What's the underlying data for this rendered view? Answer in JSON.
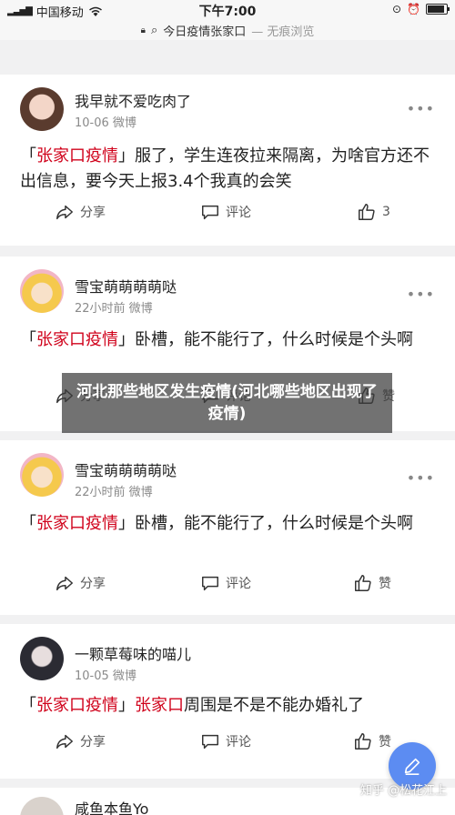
{
  "status": {
    "carrier": "中国移动",
    "time": "下午7:00"
  },
  "url": {
    "title": "今日疫情张家口",
    "suffix": "— 无痕浏览"
  },
  "overlay_title": "河北那些地区发生疫情(河北哪些地区出现了疫情)",
  "watermark": "知乎 @松花江上",
  "posts": [
    {
      "name": "我早就不爱吃肉了",
      "meta": "10-06  微博",
      "prefix": "「",
      "highlight": "张家口疫情",
      "close": "」",
      "highlight2": "",
      "text": "服了，学生连夜拉来隔离，为啥官方还不出信息，要今天上报3.4个我真的会笑",
      "share": "分享",
      "comment": "评论",
      "like": "3"
    },
    {
      "name": "雪宝萌萌萌萌哒",
      "meta": "22小时前  微博",
      "prefix": "「",
      "highlight": "张家口疫情",
      "close": "」",
      "highlight2": "",
      "text": "卧槽，能不能行了，什么时候是个头啊",
      "share": "分享",
      "comment": "评论",
      "like": "赞"
    },
    {
      "name": "雪宝萌萌萌萌哒",
      "meta": "22小时前  微博",
      "prefix": "「",
      "highlight": "张家口疫情",
      "close": "」",
      "highlight2": "",
      "text": "卧槽，能不能行了，什么时候是个头啊",
      "share": "分享",
      "comment": "评论",
      "like": "赞"
    },
    {
      "name": "一颗草莓味的喵儿",
      "meta": "10-05  微博",
      "prefix": "「",
      "highlight": "张家口疫情",
      "close": "」",
      "highlight2": "张家口",
      "text": "周围是不是不能办婚礼了",
      "share": "分享",
      "comment": "评论",
      "like": "赞"
    },
    {
      "name": "咸鱼本鱼Yo"
    }
  ]
}
